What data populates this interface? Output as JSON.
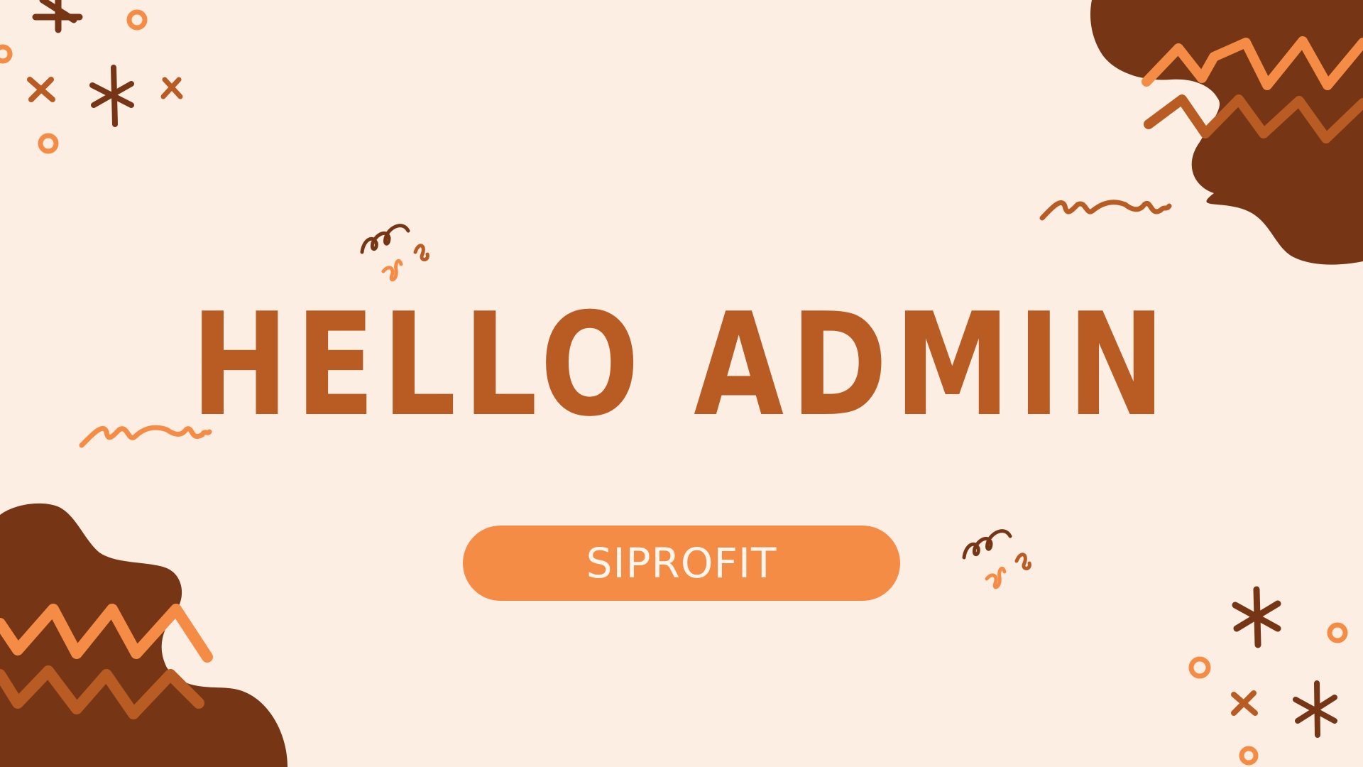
{
  "heading": "HELLO ADMIN",
  "badge": "SIPROFIT",
  "colors": {
    "background": "#fdeee4",
    "heading": "#b85c24",
    "badge": "#f58c45",
    "badge_text": "#fff5ec",
    "dark_blob": "#763615",
    "accent_orange": "#f58c45",
    "accent_rust": "#b85c24"
  }
}
